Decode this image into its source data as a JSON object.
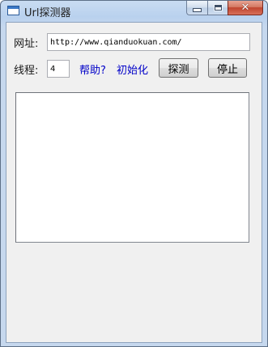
{
  "window": {
    "title": "Url探测器",
    "close_glyph": "✕"
  },
  "form": {
    "url_label": "网址:",
    "url_value": "http://www.qianduokuan.com/",
    "thread_label": "线程:",
    "thread_value": "4",
    "help_link": "帮助?",
    "init_link": "初始化",
    "detect_button": "探测",
    "stop_button": "停止"
  },
  "results": {
    "text": ""
  },
  "colors": {
    "link": "#0000c8",
    "client_bg": "#f0f0f0",
    "close_button": "#c0452f"
  },
  "icons": [
    "app-window-icon",
    "minimize-icon",
    "maximize-icon",
    "close-icon"
  ]
}
